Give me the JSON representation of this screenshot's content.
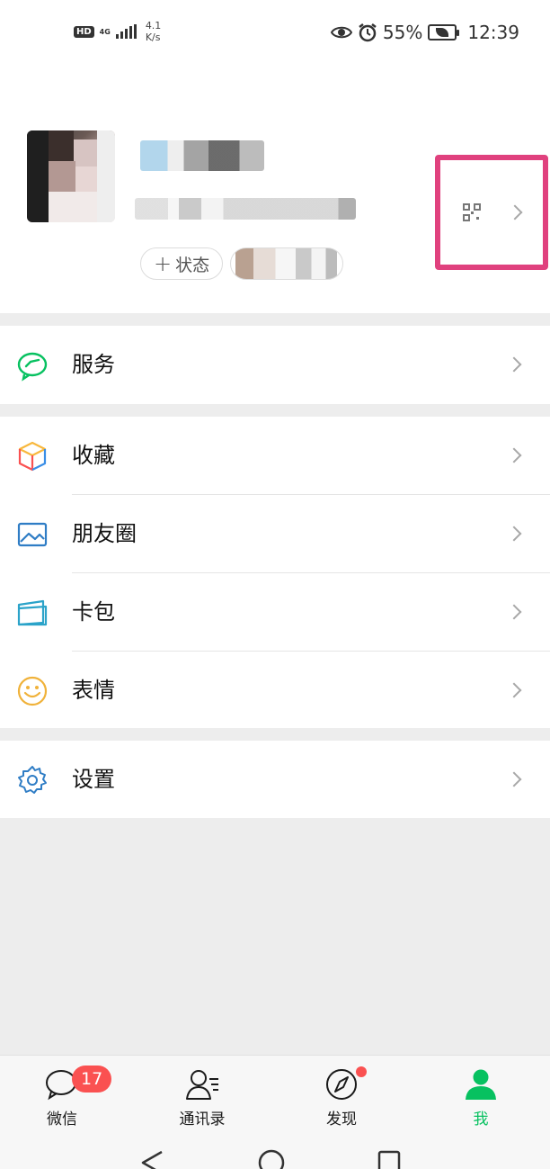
{
  "status_bar": {
    "hd": "HD",
    "network": "4G",
    "speed_value": "4.1",
    "speed_unit": "K/s",
    "battery_percent": "55%",
    "time": "12:39"
  },
  "profile": {
    "status_plus": "+",
    "status_label": "状态"
  },
  "menu": {
    "services": "服务",
    "favorites": "收藏",
    "moments": "朋友圈",
    "cards": "卡包",
    "stickers": "表情",
    "settings": "设置"
  },
  "tabbar": {
    "chats_label": "微信",
    "chats_badge": "17",
    "contacts_label": "通讯录",
    "discover_label": "发现",
    "me_label": "我"
  },
  "colors": {
    "accent_green": "#07c160",
    "badge_red": "#fa5151",
    "highlight_pink": "#e0417e"
  }
}
